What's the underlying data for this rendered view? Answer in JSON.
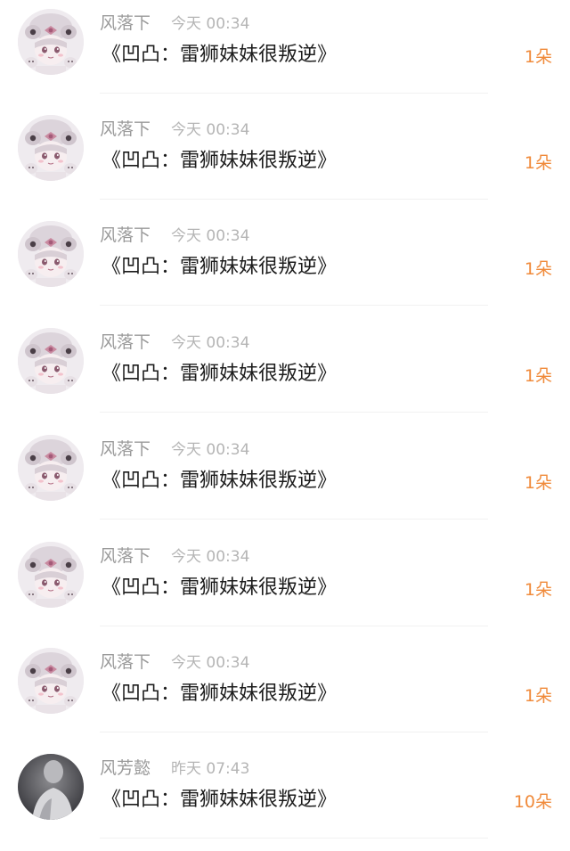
{
  "comments": [
    {
      "username": "风落下",
      "time": "今天 00:34",
      "title": "《凹凸：雷狮妹妹很叛逆》",
      "count": "1朵",
      "avatar": "anime-girl-avatar"
    },
    {
      "username": "风落下",
      "time": "今天 00:34",
      "title": "《凹凸：雷狮妹妹很叛逆》",
      "count": "1朵",
      "avatar": "anime-girl-avatar"
    },
    {
      "username": "风落下",
      "time": "今天 00:34",
      "title": "《凹凸：雷狮妹妹很叛逆》",
      "count": "1朵",
      "avatar": "anime-girl-avatar"
    },
    {
      "username": "风落下",
      "time": "今天 00:34",
      "title": "《凹凸：雷狮妹妹很叛逆》",
      "count": "1朵",
      "avatar": "anime-girl-avatar"
    },
    {
      "username": "风落下",
      "time": "今天 00:34",
      "title": "《凹凸：雷狮妹妹很叛逆》",
      "count": "1朵",
      "avatar": "anime-girl-avatar"
    },
    {
      "username": "风落下",
      "time": "今天 00:34",
      "title": "《凹凸：雷狮妹妹很叛逆》",
      "count": "1朵",
      "avatar": "anime-girl-avatar"
    },
    {
      "username": "风落下",
      "time": "今天 00:34",
      "title": "《凹凸：雷狮妹妹很叛逆》",
      "count": "1朵",
      "avatar": "anime-girl-avatar"
    },
    {
      "username": "风芳懿",
      "time": "昨天 07:43",
      "title": "《凹凸：雷狮妹妹很叛逆》",
      "count": "10朵",
      "avatar": "dark-photo-avatar"
    }
  ],
  "colors": {
    "username": "#9a9a9a",
    "time": "#b5b5b5",
    "title": "#1c1c1c",
    "count_accent": "#f08a3a",
    "divider": "#f1f1f1"
  }
}
